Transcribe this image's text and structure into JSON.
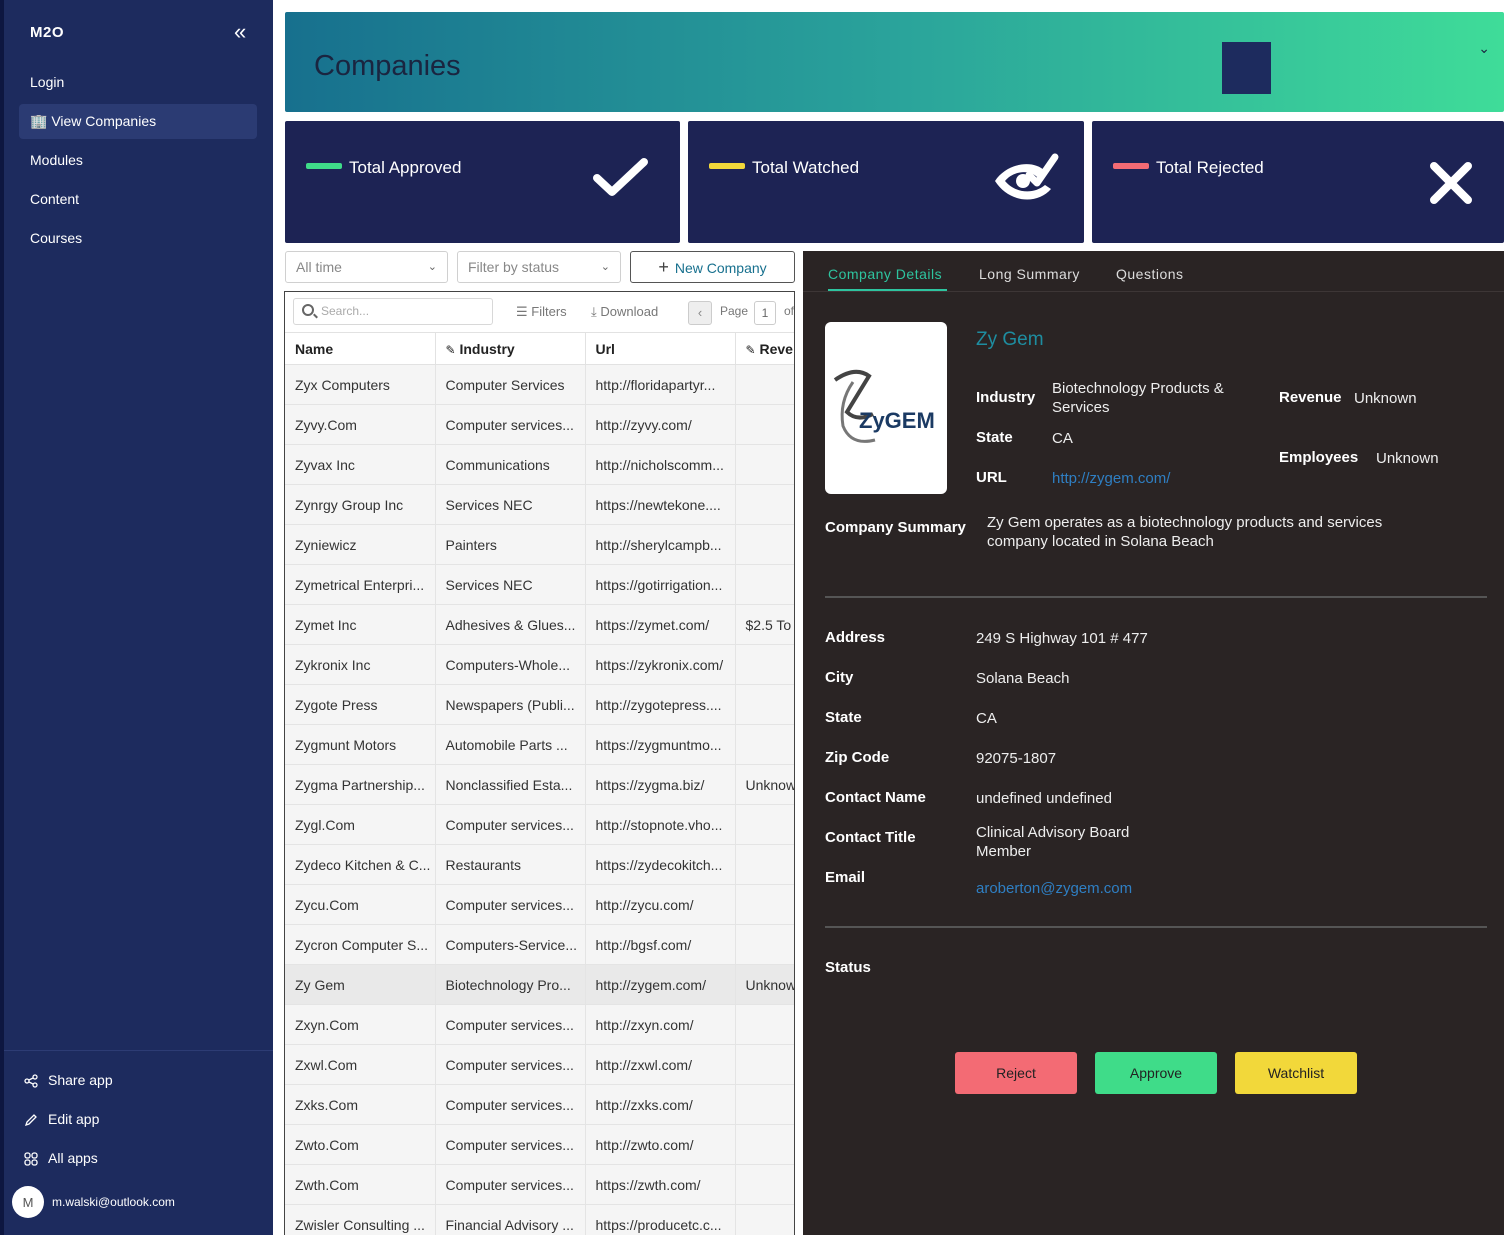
{
  "sidebar": {
    "brand": "M2O",
    "items": [
      {
        "label": "Login"
      },
      {
        "label": "🏢 View Companies"
      },
      {
        "label": "Modules"
      },
      {
        "label": "Content"
      },
      {
        "label": "Courses"
      }
    ],
    "footer": [
      {
        "label": "Share app",
        "icon": "share-icon"
      },
      {
        "label": "Edit app",
        "icon": "pencil-icon"
      },
      {
        "label": "All apps",
        "icon": "grid-icon"
      }
    ],
    "user": {
      "initial": "M",
      "email": "m.walski@outlook.com"
    }
  },
  "header": {
    "title": "Companies"
  },
  "stats": [
    {
      "label": "Total Approved",
      "color": "#3fdc89",
      "icon": "check-icon"
    },
    {
      "label": "Total Watched",
      "color": "#f2d83a",
      "icon": "eye-check-icon"
    },
    {
      "label": "Total Rejected",
      "color": "#f36b74",
      "icon": "close-icon"
    }
  ],
  "controls": {
    "time_filter": "All time",
    "status_filter": "Filter by status",
    "new_company": "New Company"
  },
  "toolbar": {
    "search_placeholder": "Search...",
    "filters": "Filters",
    "download": "Download",
    "page_label": "Page",
    "page_number": "1",
    "of_label": "of"
  },
  "table": {
    "headers": [
      "Name",
      "Industry",
      "Url",
      "Reve"
    ],
    "rows": [
      [
        "Zyx Computers",
        "Computer Services",
        "http://floridapartyr...",
        ""
      ],
      [
        "Zyvy.Com",
        "Computer services...",
        "http://zyvy.com/",
        ""
      ],
      [
        "Zyvax Inc",
        "Communications",
        "http://nicholscomm...",
        ""
      ],
      [
        "Zynrgy Group Inc",
        "Services NEC",
        "https://newtekone....",
        ""
      ],
      [
        "Zyniewicz",
        "Painters",
        "http://sherylcampb...",
        ""
      ],
      [
        "Zymetrical Enterpri...",
        "Services NEC",
        "https://gotirrigation...",
        ""
      ],
      [
        "Zymet Inc",
        "Adhesives & Glues...",
        "https://zymet.com/",
        "$2.5 To"
      ],
      [
        "Zykronix Inc",
        "Computers-Whole...",
        "https://zykronix.com/",
        ""
      ],
      [
        "Zygote Press",
        "Newspapers (Publi...",
        "http://zygotepress....",
        ""
      ],
      [
        "Zygmunt Motors",
        "Automobile Parts ...",
        "https://zygmuntmo...",
        ""
      ],
      [
        "Zygma Partnership...",
        "Nonclassified Esta...",
        "https://zygma.biz/",
        "Unknow"
      ],
      [
        "Zygl.Com",
        "Computer services...",
        "http://stopnote.vho...",
        ""
      ],
      [
        "Zydeco Kitchen & C...",
        "Restaurants",
        "https://zydecokitch...",
        ""
      ],
      [
        "Zycu.Com",
        "Computer services...",
        "http://zycu.com/",
        ""
      ],
      [
        "Zycron Computer S...",
        "Computers-Service...",
        "http://bgsf.com/",
        ""
      ],
      [
        "Zy Gem",
        "Biotechnology Pro...",
        "http://zygem.com/",
        "Unknow"
      ],
      [
        "Zxyn.Com",
        "Computer services...",
        "http://zxyn.com/",
        ""
      ],
      [
        "Zxwl.Com",
        "Computer services...",
        "http://zxwl.com/",
        ""
      ],
      [
        "Zxks.Com",
        "Computer services...",
        "http://zxks.com/",
        ""
      ],
      [
        "Zwto.Com",
        "Computer services...",
        "http://zwto.com/",
        ""
      ],
      [
        "Zwth.Com",
        "Computer services...",
        "https://zwth.com/",
        ""
      ],
      [
        "Zwisler Consulting ...",
        "Financial Advisory ...",
        "https://producetc.c...",
        ""
      ]
    ]
  },
  "details": {
    "tabs": [
      "Company Details",
      "Long Summary",
      "Questions"
    ],
    "logo_text": "ZyGEM",
    "name": "Zy Gem",
    "industry_label": "Industry",
    "industry": "Biotechnology Products & Services",
    "state_label": "State",
    "state": "CA",
    "url_label": "URL",
    "url": "http://zygem.com/",
    "revenue_label": "Revenue",
    "revenue": "Unknown",
    "employees_label": "Employees",
    "employees": "Unknown",
    "summary_label": "Company Summary",
    "summary": "Zy Gem operates as a biotechnology products and services company located in Solana Beach",
    "address_label": "Address",
    "address": "249 S Highway 101 # 477",
    "city_label": "City",
    "city": "Solana Beach",
    "state2_label": "State",
    "state2": "CA",
    "zip_label": "Zip Code",
    "zip": "92075-1807",
    "contact_name_label": "Contact Name",
    "contact_name": "undefined undefined",
    "contact_title_label": "Contact Title",
    "contact_title": "Clinical Advisory Board Member",
    "email_label": "Email",
    "email": "aroberton@zygem.com",
    "status_label": "Status",
    "buttons": {
      "reject": "Reject",
      "approve": "Approve",
      "watchlist": "Watchlist"
    }
  }
}
